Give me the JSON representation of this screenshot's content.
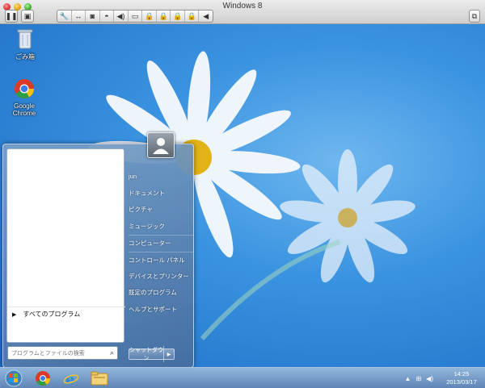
{
  "window": {
    "title": "Windows 8",
    "toolbar_icons": [
      "pause-icon",
      "snapshot-icon",
      "wrench-icon",
      "resize-arrows-icon",
      "disk-icon",
      "lock-icon",
      "speaker-icon",
      "camera-icon",
      "lock-icon",
      "lock-icon",
      "lock-icon",
      "left-arrow-icon"
    ]
  },
  "desktop": {
    "icons": [
      {
        "label": "ごみ箱",
        "icon": "recycle-bin-icon"
      },
      {
        "label": "Google Chrome",
        "icon": "chrome-icon"
      }
    ]
  },
  "start_menu": {
    "user_name": "jun",
    "right_items": [
      "ドキュメント",
      "ピクチャ",
      "ミュージック",
      "コンピューター",
      "コントロール パネル",
      "デバイスとプリンター",
      "既定のプログラム",
      "ヘルプとサポート"
    ],
    "all_programs": "すべてのプログラム",
    "search_placeholder": "プログラムとファイルの検索",
    "shutdown_label": "シャットダウン"
  },
  "taskbar": {
    "apps": [
      "start-orb-icon",
      "chrome-icon",
      "internet-explorer-icon",
      "explorer-folder-icon"
    ],
    "clock_time": "14:25",
    "clock_date": "2013/03/17"
  }
}
